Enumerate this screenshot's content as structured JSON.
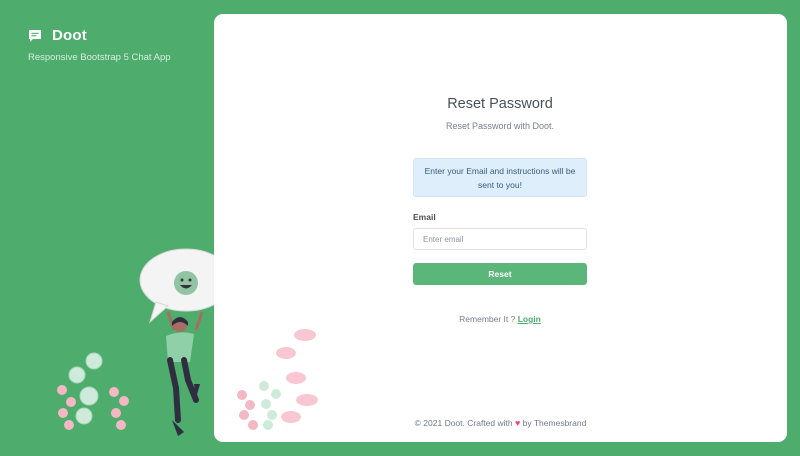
{
  "brand": {
    "name": "Doot",
    "tagline": "Responsive Bootstrap 5 Chat App",
    "icon": "message-square-icon"
  },
  "auth": {
    "title": "Reset Password",
    "subtitle": "Reset Password with Doot.",
    "alert": "Enter your Email and instructions will be sent to you!",
    "email_label": "Email",
    "email_placeholder": "Enter email",
    "email_value": "",
    "reset_button": "Reset",
    "remember_text": "Remember It ? ",
    "login_link": "Login"
  },
  "footer": {
    "prefix": "© 2021 Doot. Crafted with ",
    "heart_icon": "heart-icon",
    "suffix": " by Themesbrand"
  },
  "colors": {
    "primary": "#4eac6d",
    "button": "#5bb679",
    "alert_bg": "#dfeefb",
    "alert_text": "#355d82",
    "heart": "#ef476f"
  }
}
